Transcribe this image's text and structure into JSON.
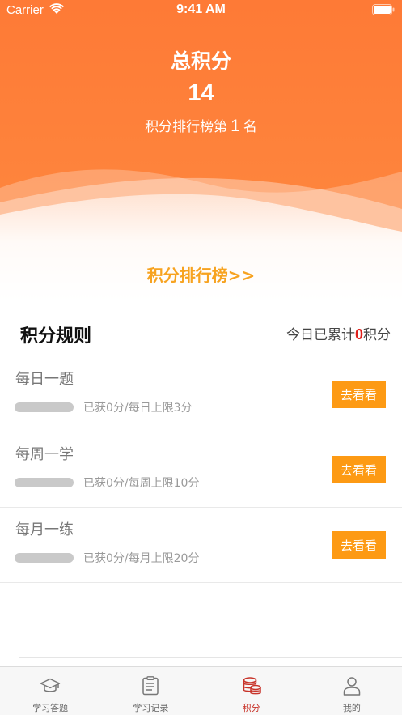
{
  "status_bar": {
    "carrier": "Carrier",
    "time": "9:41 AM"
  },
  "hero": {
    "title": "总积分",
    "total": "14",
    "rank_prefix": "积分排行榜第",
    "rank_number": "1",
    "rank_suffix": "名",
    "leaderboard_link": "积分排行榜>>"
  },
  "rules": {
    "title": "积分规则",
    "today_prefix": "今日已累计",
    "today_points": "0",
    "today_suffix": "积分"
  },
  "tasks": [
    {
      "name": "每日一题",
      "status": "已获0分/每日上限3分",
      "button": "去看看",
      "progress": 0
    },
    {
      "name": "每周一学",
      "status": "已获0分/每周上限10分",
      "button": "去看看",
      "progress": 0
    },
    {
      "name": "每月一练",
      "status": "已获0分/每月上限20分",
      "button": "去看看",
      "progress": 0
    }
  ],
  "tabs": [
    {
      "label": "学习答题",
      "icon": "graduation-cap-icon"
    },
    {
      "label": "学习记录",
      "icon": "clipboard-icon"
    },
    {
      "label": "积分",
      "icon": "coins-icon",
      "active": true
    },
    {
      "label": "我的",
      "icon": "user-icon"
    }
  ],
  "colors": {
    "hero_orange": "#fe7a36",
    "link_orange": "#f7a320",
    "button_orange": "#fd9a14",
    "highlight_red": "#e0201b",
    "active_tab": "#c8342a"
  }
}
